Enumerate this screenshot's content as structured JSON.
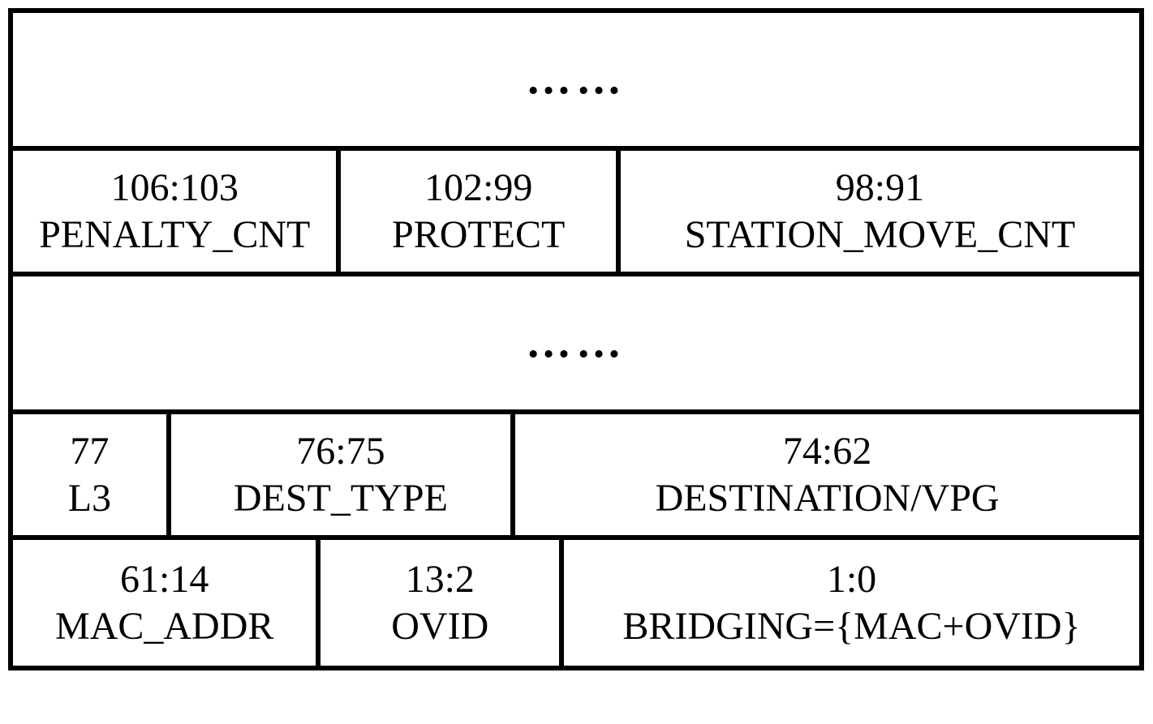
{
  "ellipsis": "……",
  "rows": {
    "r2": {
      "c1": {
        "bits": "106:103",
        "name": "PENALTY_CNT"
      },
      "c2": {
        "bits": "102:99",
        "name": "PROTECT"
      },
      "c3": {
        "bits": "98:91",
        "name": "STATION_MOVE_CNT"
      }
    },
    "r4": {
      "c1": {
        "bits": "77",
        "name": "L3"
      },
      "c2": {
        "bits": "76:75",
        "name": "DEST_TYPE"
      },
      "c3": {
        "bits": "74:62",
        "name": "DESTINATION/VPG"
      }
    },
    "r5": {
      "c1": {
        "bits": "61:14",
        "name": "MAC_ADDR"
      },
      "c2": {
        "bits": "13:2",
        "name": "OVID"
      },
      "c3": {
        "bits": "1:0",
        "name": "BRIDGING={MAC+OVID}"
      }
    }
  }
}
